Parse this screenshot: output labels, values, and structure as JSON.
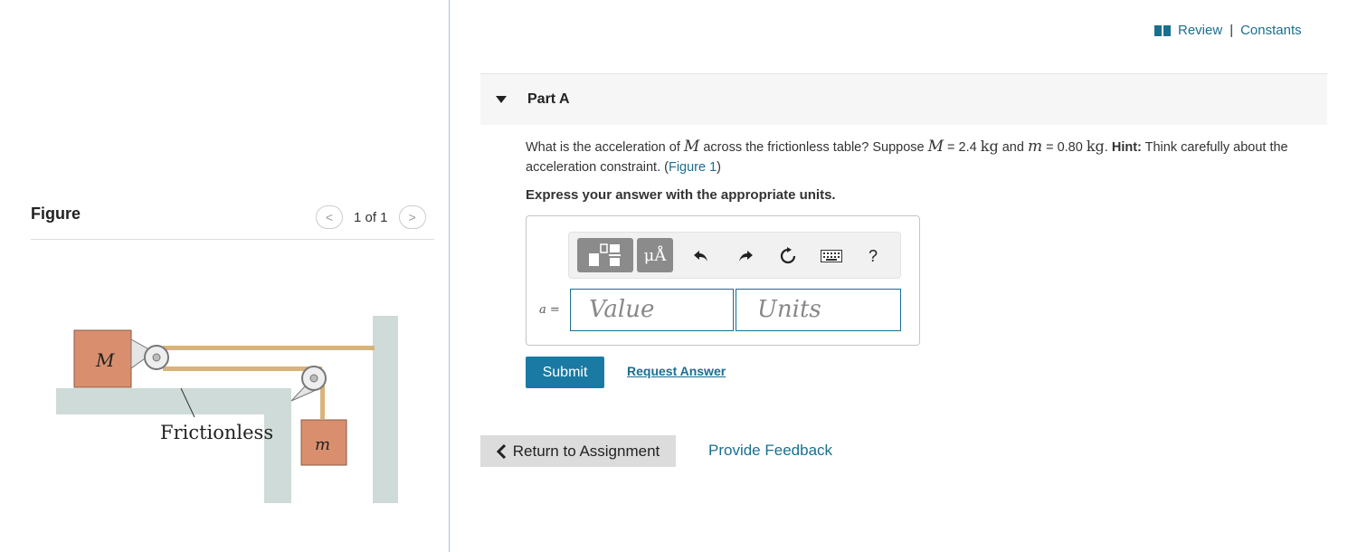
{
  "review": {
    "review_label": "Review",
    "separator": "|",
    "constants_label": "Constants"
  },
  "part": {
    "title": "Part A"
  },
  "question": {
    "t1": "What is the acceleration of ",
    "M": "M",
    "t2": " across the frictionless table? Suppose ",
    "M2": "M",
    "t3": " = 2.4 ",
    "kg1": "kg",
    "t4": " and ",
    "m": "m",
    "t5": " = 0.80 ",
    "kg2": "kg",
    "t6": ". ",
    "hint_label": "Hint:",
    "t7": " Think carefully about the acceleration constraint. (",
    "figure_link": "Figure 1",
    "t8": ")"
  },
  "instructions": "Express your answer with the appropriate units.",
  "answer": {
    "variable": "a",
    "equals": "=",
    "value_placeholder": "Value",
    "units_placeholder": "Units"
  },
  "toolbar": {
    "templates_icon": "templates-icon",
    "units_symbol": "μÅ",
    "undo_icon": "undo-icon",
    "redo_icon": "redo-icon",
    "reset_icon": "reset-icon",
    "keyboard_icon": "keyboard-icon",
    "help_label": "?"
  },
  "buttons": {
    "submit": "Submit",
    "request_answer": "Request Answer",
    "return": "Return to Assignment",
    "feedback": "Provide Feedback"
  },
  "figure": {
    "title": "Figure",
    "pager": "1 of 1",
    "label_M": "M",
    "label_m": "m",
    "label_frictionless": "Frictionless"
  },
  "colors": {
    "accent": "#1a6f8f",
    "submit_bg": "#1a7aa3",
    "block": "#d98f6e",
    "table": "#cfdbd8"
  }
}
